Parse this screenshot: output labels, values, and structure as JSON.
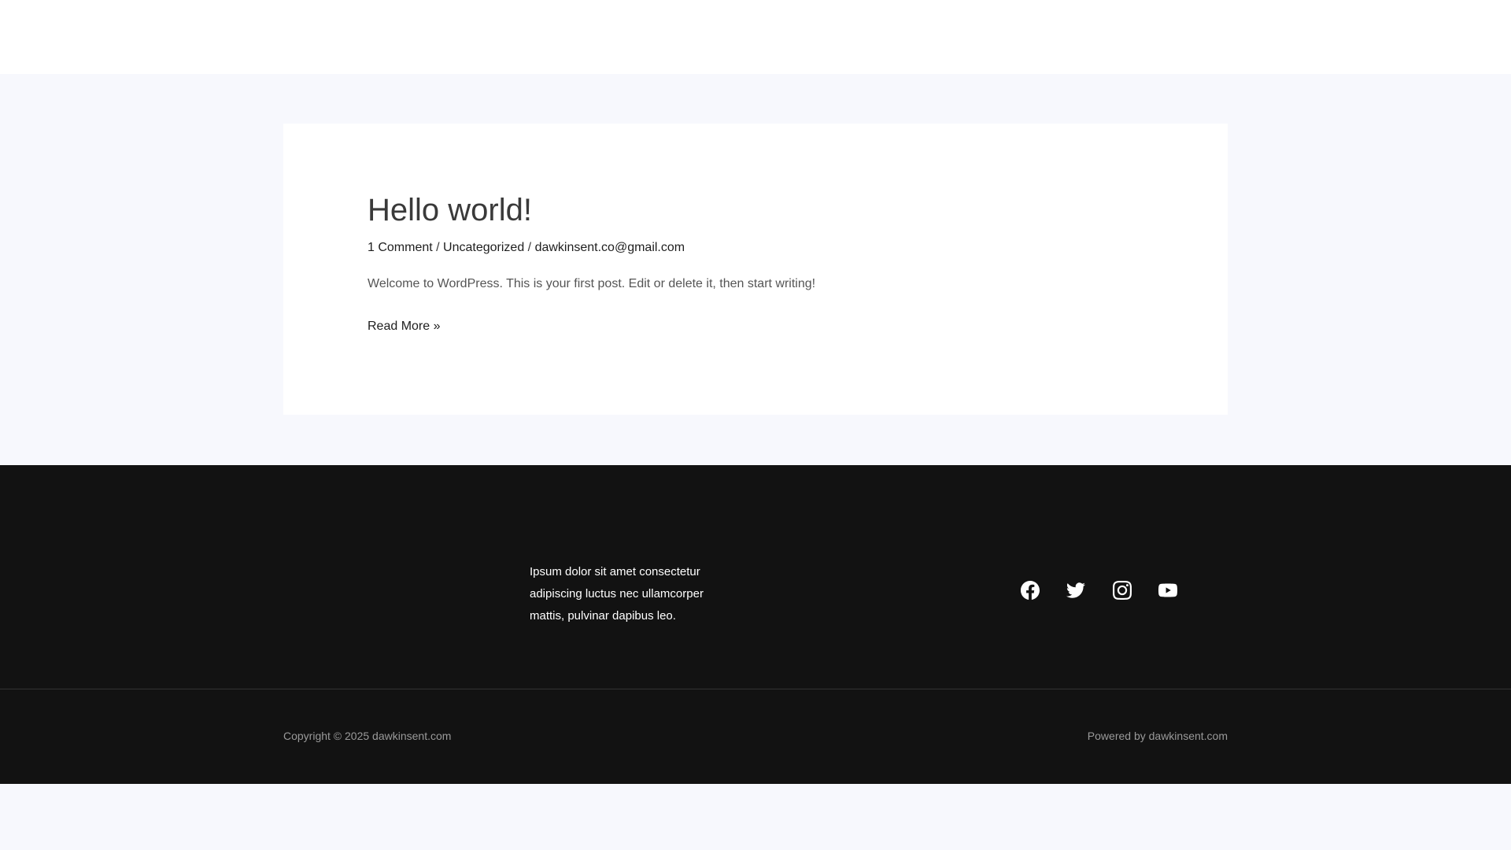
{
  "post": {
    "title": "Hello world!",
    "meta": {
      "comments": "1 Comment",
      "category": "Uncategorized",
      "author": "dawkinsent.co@gmail.com",
      "separator": " / "
    },
    "excerpt": "Welcome to WordPress. This is your first post. Edit or delete it, then start writing!",
    "read_more": "Read More »"
  },
  "footer": {
    "text": "Ipsum dolor sit amet consectetur adipiscing luctus nec ullamcorper mattis, pulvinar dapibus leo.",
    "social": [
      "facebook-icon",
      "twitter-icon",
      "instagram-icon",
      "youtube-icon"
    ],
    "copyright": "Copyright © 2025 dawkinsent.com",
    "powered": "Powered by dawkinsent.com"
  },
  "colors": {
    "page_bg": "#f7f8fd",
    "footer_bg": "#121212",
    "text": "#3a3a3a"
  }
}
